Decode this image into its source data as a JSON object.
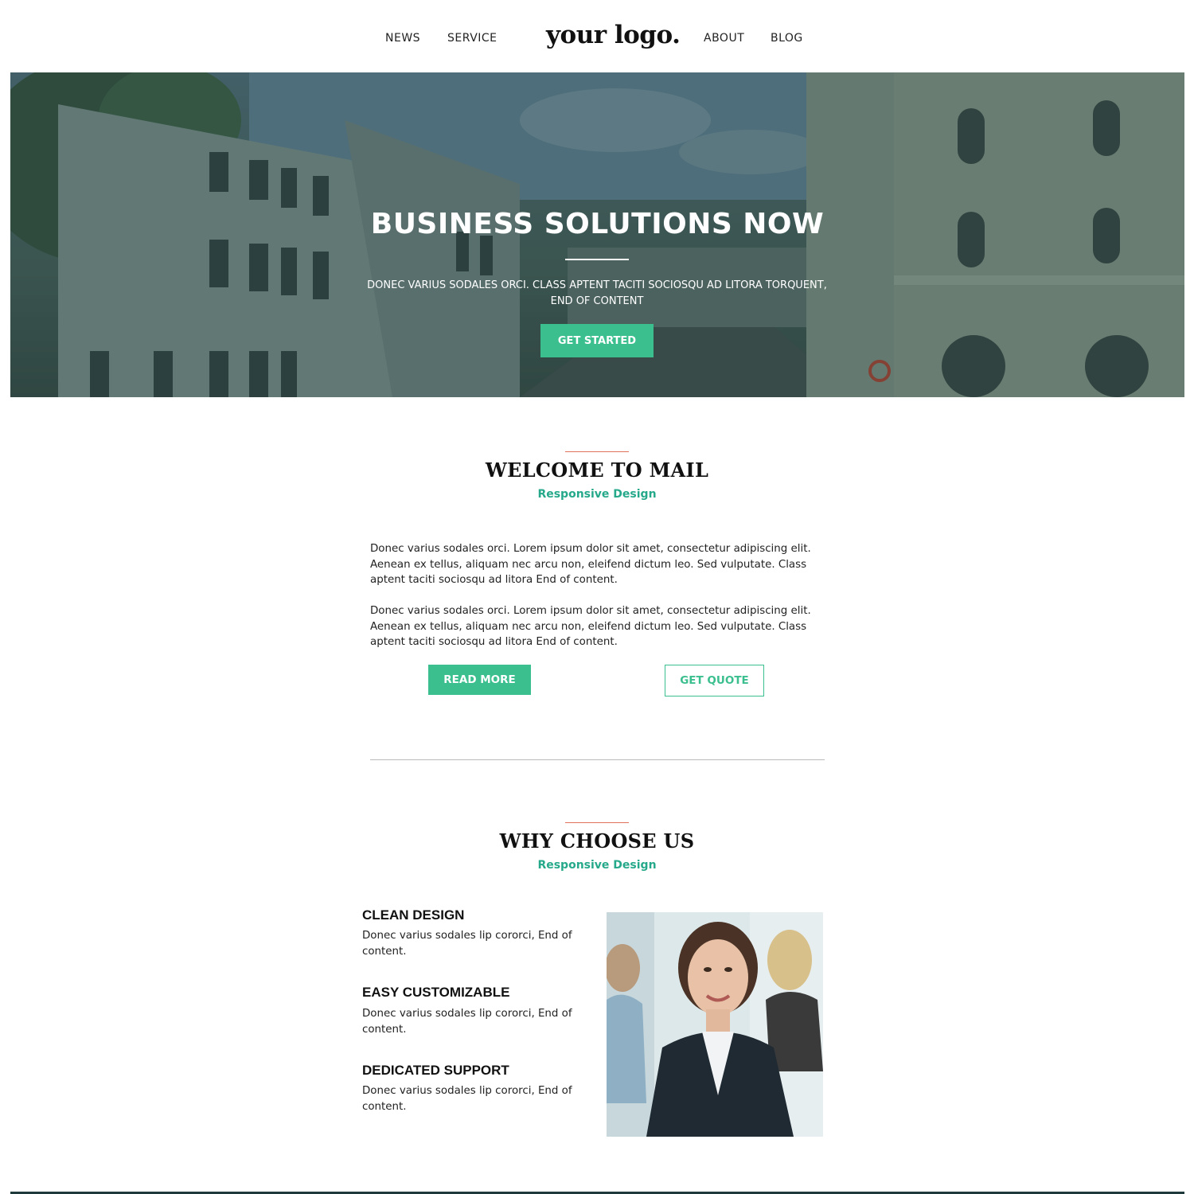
{
  "header": {
    "nav_left": [
      "NEWS",
      "SERVICE"
    ],
    "logo": "your logo.",
    "nav_right": [
      "ABOUT",
      "BLOG"
    ]
  },
  "hero": {
    "title": "BUSINESS SOLUTIONS NOW",
    "subtitle": "DONEC VARIUS SODALES ORCI. CLASS APTENT TACITI SOCIOSQU AD LITORA TORQUENT, END OF CONTENT",
    "cta": "GET STARTED"
  },
  "welcome": {
    "title": "WELCOME TO MAIL",
    "subtitle": "Responsive Design",
    "paragraphs": [
      "Donec varius sodales orci. Lorem ipsum dolor sit amet, consectetur adipiscing elit. Aenean ex tellus, aliquam nec arcu non, eleifend dictum leo. Sed vulputate. Class aptent taciti sociosqu ad litora End of content.",
      "Donec varius sodales orci. Lorem ipsum dolor sit amet, consectetur adipiscing elit. Aenean ex tellus, aliquam nec arcu non, eleifend dictum leo. Sed vulputate. Class aptent taciti sociosqu ad litora End of content."
    ],
    "read_more": "READ MORE",
    "get_quote": "GET QUOTE"
  },
  "why": {
    "title": "WHY CHOOSE US",
    "subtitle": "Responsive Design",
    "features": [
      {
        "title": "CLEAN DESIGN",
        "text": "Donec varius sodales lip cororci, End of content."
      },
      {
        "title": "EASY CUSTOMIZABLE",
        "text": "Donec varius sodales lip cororci, End of content."
      },
      {
        "title": "DEDICATED SUPPORT",
        "text": "Donec varius sodales lip cororci, End of content."
      }
    ]
  },
  "colors": {
    "accent_green": "#3bbf8f",
    "subtitle_green": "#26a98a",
    "accent_red": "#e0725c"
  }
}
